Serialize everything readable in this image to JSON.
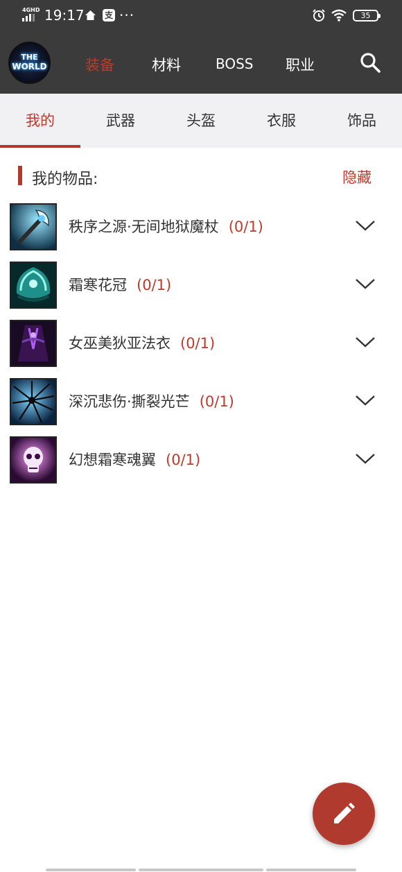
{
  "status_bar": {
    "network": "4GHD",
    "time": "19:17",
    "box_glyph": "支",
    "more": "···",
    "battery": "35",
    "icons": [
      "signal-icon",
      "home-icon",
      "alipay-icon",
      "alarm-icon",
      "wifi-icon",
      "battery-icon"
    ]
  },
  "appbar": {
    "logo_line1": "THE",
    "logo_line2": "WORLD",
    "tabs": [
      {
        "label": "装备",
        "active": true
      },
      {
        "label": "材料",
        "active": false
      },
      {
        "label": "BOSS",
        "active": false
      },
      {
        "label": "职业",
        "active": false
      }
    ],
    "search_icon": "search-icon"
  },
  "subtabs": [
    {
      "label": "我的",
      "active": true
    },
    {
      "label": "武器",
      "active": false
    },
    {
      "label": "头盔",
      "active": false
    },
    {
      "label": "衣服",
      "active": false
    },
    {
      "label": "饰品",
      "active": false
    }
  ],
  "section": {
    "title": "我的物品:",
    "hide_label": "隐藏"
  },
  "items": [
    {
      "name": "秩序之源·无间地狱魔杖",
      "count": "(0/1)",
      "icon": "staff-icon"
    },
    {
      "name": "霜寒花冠",
      "count": "(0/1)",
      "icon": "crown-icon"
    },
    {
      "name": "女巫美狄亚法衣",
      "count": "(0/1)",
      "icon": "robe-icon"
    },
    {
      "name": "深沉悲伤·撕裂光芒",
      "count": "(0/1)",
      "icon": "shatter-icon"
    },
    {
      "name": "幻想霜寒魂翼",
      "count": "(0/1)",
      "icon": "skull-icon"
    }
  ],
  "fab": {
    "icon": "edit-pencil-icon"
  },
  "colors": {
    "accent": "#c0392b",
    "appbar_bg": "#3b3b3b",
    "subtab_bg": "#f1f1f4"
  }
}
